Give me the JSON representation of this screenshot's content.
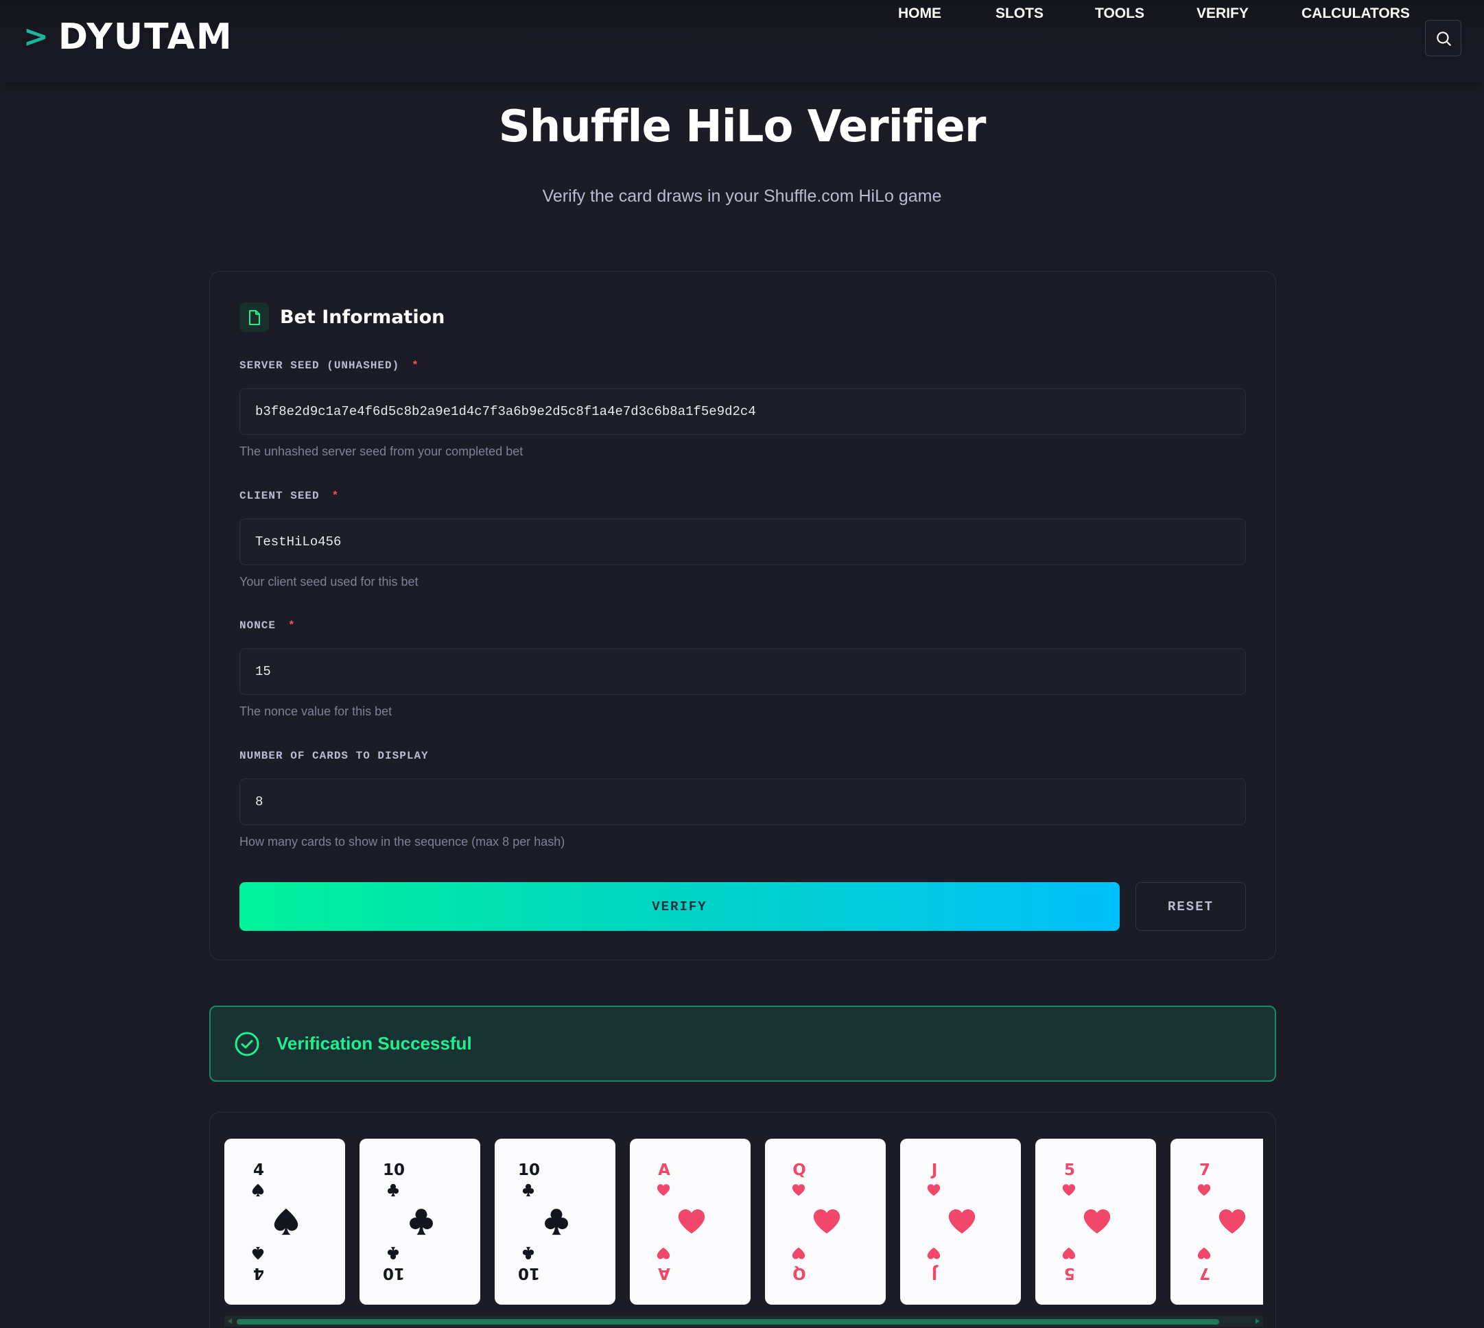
{
  "header": {
    "logo_mark": ">",
    "logo_text": "DYUTAM",
    "nav": [
      "HOME",
      "SLOTS",
      "TOOLS",
      "VERIFY",
      "CALCULATORS"
    ],
    "search_icon": "search-icon"
  },
  "page": {
    "title": "Shuffle HiLo Verifier",
    "subtitle": "Verify the card draws in your Shuffle.com HiLo game"
  },
  "form": {
    "title": "Bet Information",
    "icon": "document-icon",
    "server_seed": {
      "label": "SERVER SEED (UNHASHED)",
      "required": "*",
      "value": "b3f8e2d9c1a7e4f6d5c8b2a9e1d4c7f3a6b9e2d5c8f1a4e7d3c6b8a1f5e9d2c4",
      "help": "The unhashed server seed from your completed bet"
    },
    "client_seed": {
      "label": "CLIENT SEED",
      "required": "*",
      "value": "TestHiLo456",
      "help": "Your client seed used for this bet"
    },
    "nonce": {
      "label": "NONCE",
      "required": "*",
      "value": "15",
      "help": "The nonce value for this bet"
    },
    "num_cards": {
      "label": "NUMBER OF CARDS TO DISPLAY",
      "value": "8",
      "help": "How many cards to show in the sequence (max 8 per hash)"
    },
    "verify_label": "VERIFY",
    "reset_label": "RESET"
  },
  "result": {
    "status": "Verification Successful",
    "icon": "check-circle-icon",
    "cards": [
      {
        "rank": "4",
        "suit": "spades",
        "color": "#14161f"
      },
      {
        "rank": "10",
        "suit": "clubs",
        "color": "#14161f"
      },
      {
        "rank": "10",
        "suit": "clubs",
        "color": "#14161f"
      },
      {
        "rank": "A",
        "suit": "hearts",
        "color": "#f0476a"
      },
      {
        "rank": "Q",
        "suit": "hearts",
        "color": "#f0476a"
      },
      {
        "rank": "J",
        "suit": "hearts",
        "color": "#f0476a"
      },
      {
        "rank": "5",
        "suit": "hearts",
        "color": "#f0476a"
      },
      {
        "rank": "7",
        "suit": "hearts",
        "color": "#f0476a"
      }
    ]
  },
  "colors": {
    "background": "#1b1c26",
    "accent": "#1ff08f",
    "required": "#ff4d6d",
    "verify_gradient": [
      "#00f29a",
      "#00c0fb"
    ]
  }
}
